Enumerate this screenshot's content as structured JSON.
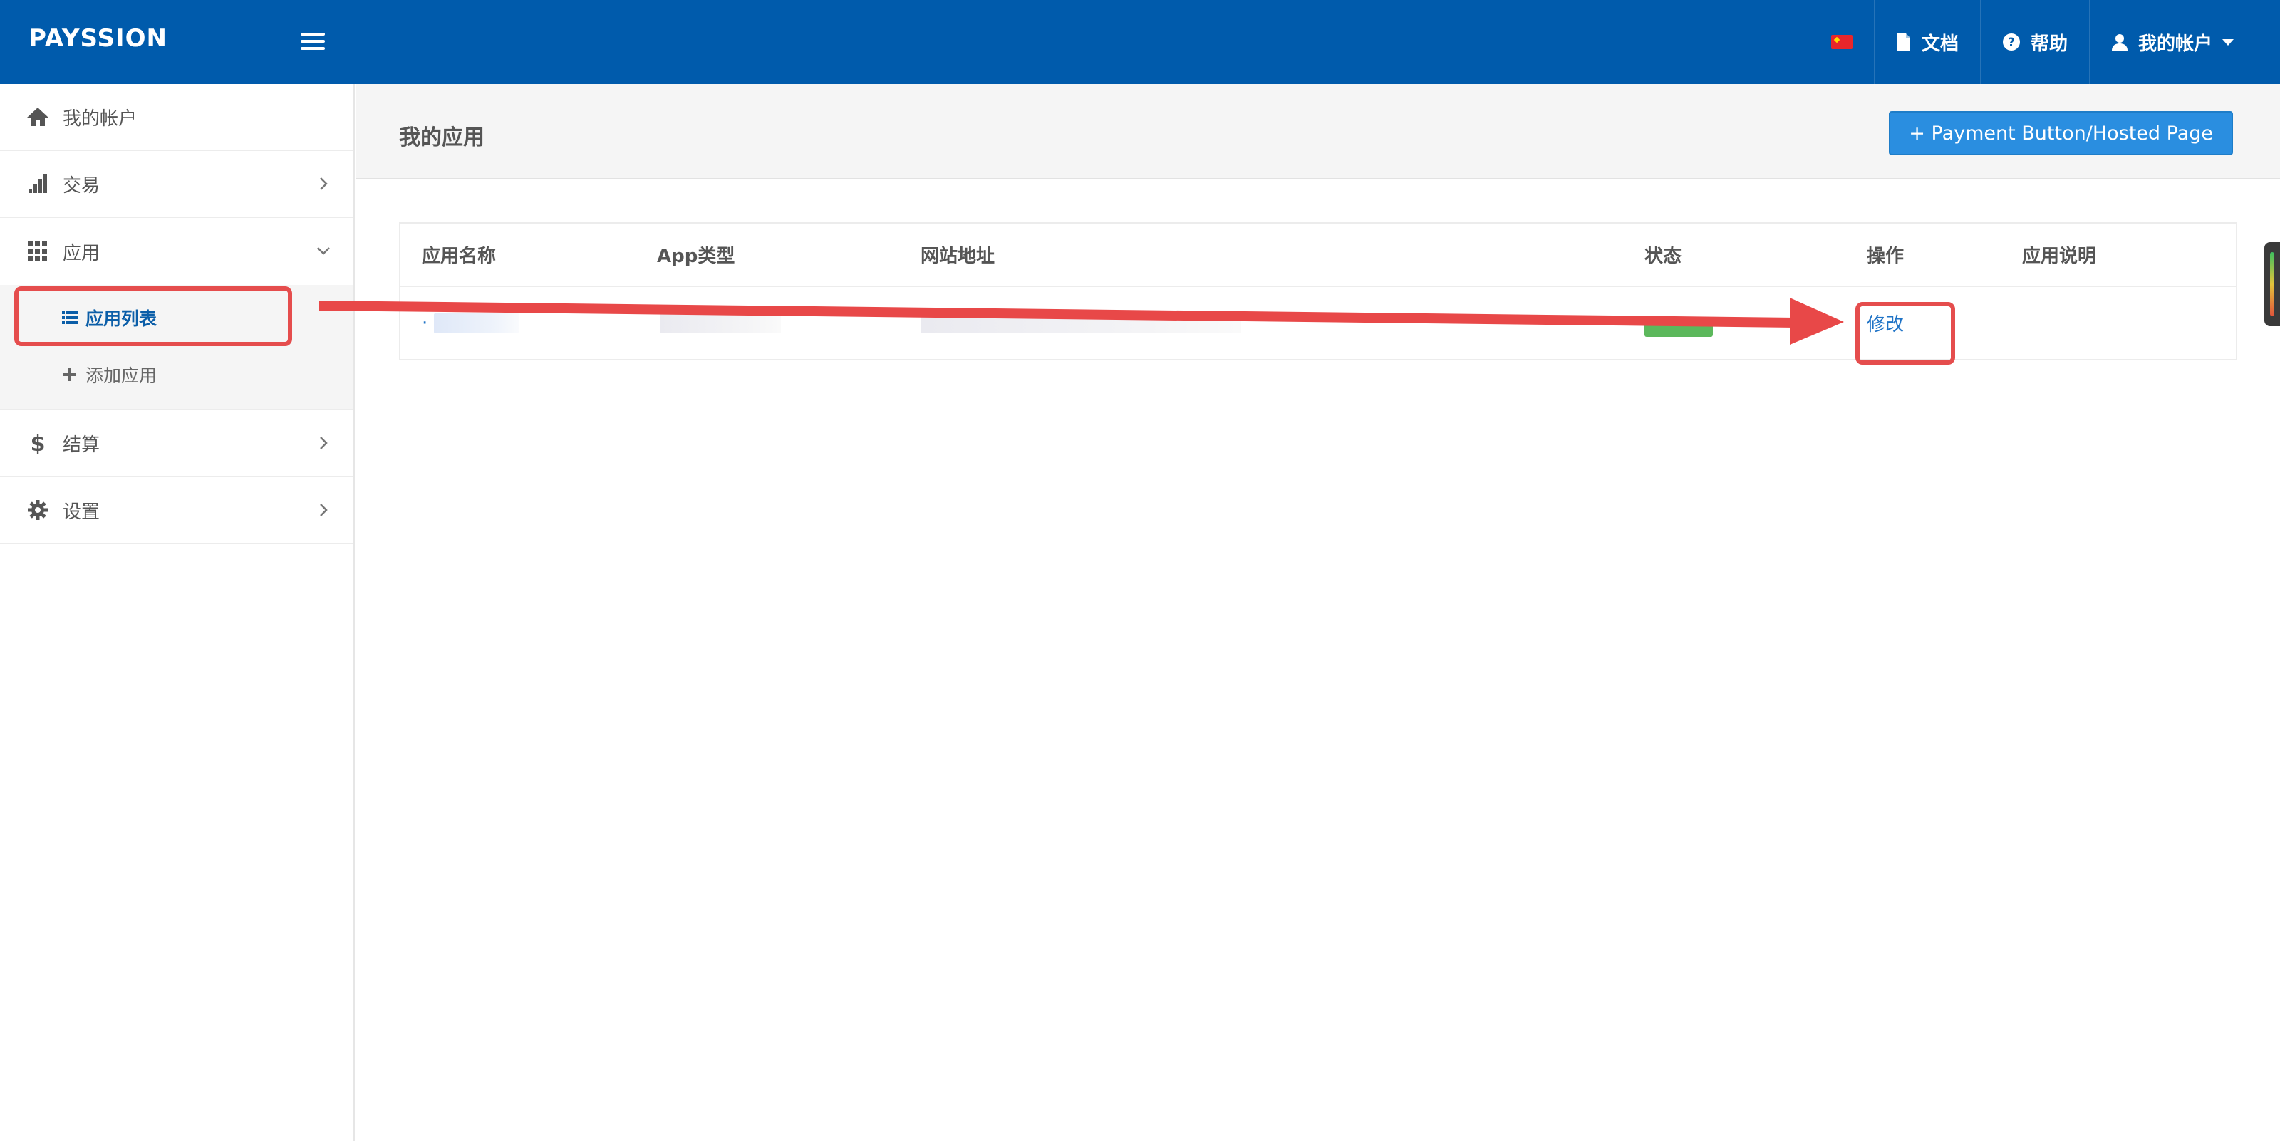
{
  "topbar": {
    "brand": "PAYSSION",
    "language_flag": "cn-flag-icon",
    "docs_label": "文档",
    "help_label": "帮助",
    "account_label": "我的帐户"
  },
  "sidebar": {
    "items": [
      {
        "label": "我的帐户",
        "icon": "home-icon"
      },
      {
        "label": "交易",
        "icon": "bar-chart-icon"
      },
      {
        "label": "应用",
        "icon": "grid-icon"
      },
      {
        "label": "结算",
        "icon": "dollar-icon"
      },
      {
        "label": "设置",
        "icon": "gear-icon"
      }
    ],
    "sub_items": [
      {
        "label": "应用列表",
        "icon": "list-icon",
        "active": true
      },
      {
        "label": "添加应用",
        "icon": "plus-icon",
        "active": false
      }
    ]
  },
  "main": {
    "title": "我的应用",
    "primary_button": "+ Payment Button/Hosted Page",
    "table": {
      "headers": [
        "应用名称",
        "App类型",
        "网站地址",
        "状态",
        "操作",
        "应用说明"
      ],
      "rows": [
        {
          "name_prefix": "·",
          "action": "修改"
        }
      ]
    }
  },
  "colors": {
    "topbar": "#005bac",
    "primary_button": "#2a8ee0",
    "link": "#1f73c6",
    "status_active": "#5cb85c",
    "annotation": "#e54d4d"
  }
}
